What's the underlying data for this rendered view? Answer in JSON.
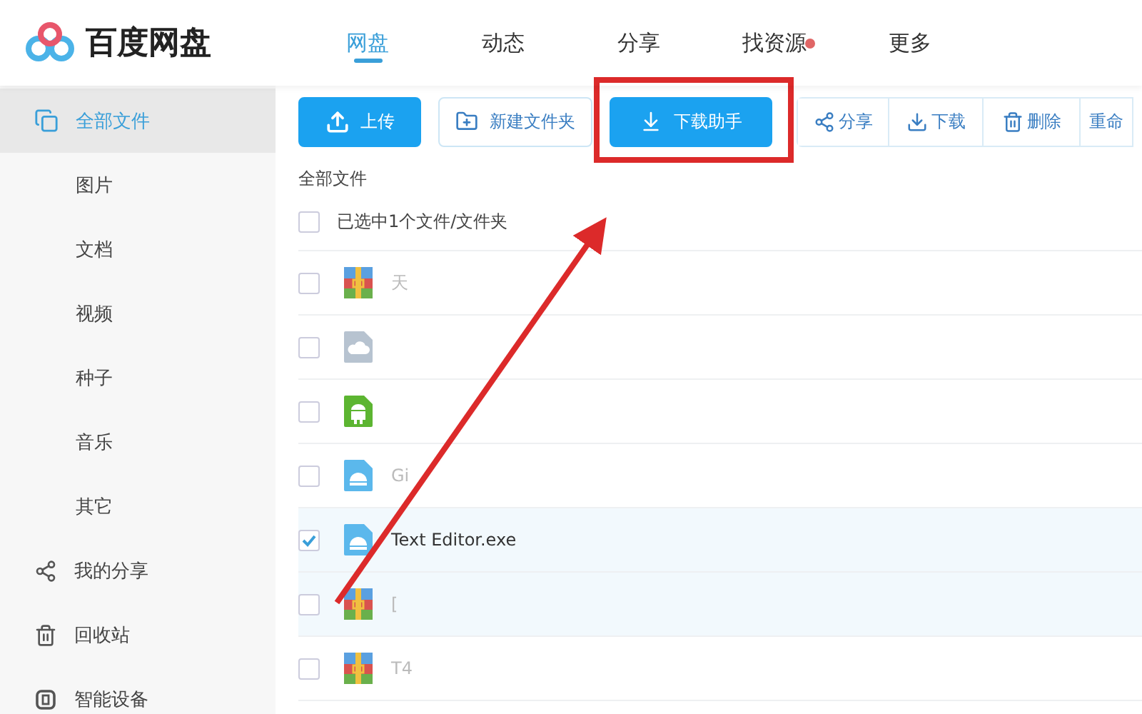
{
  "app": {
    "title": "百度网盘"
  },
  "nav_tabs": [
    {
      "label": "网盘",
      "selected": true,
      "badge": false
    },
    {
      "label": "动态",
      "selected": false,
      "badge": false
    },
    {
      "label": "分享",
      "selected": false,
      "badge": false
    },
    {
      "label": "找资源",
      "selected": false,
      "badge": true
    },
    {
      "label": "更多",
      "selected": false,
      "badge": false
    }
  ],
  "sidebar": {
    "items": [
      {
        "label": "全部文件",
        "kind": "files",
        "selected": true
      },
      {
        "label": "图片",
        "kind": "sub",
        "selected": false
      },
      {
        "label": "文档",
        "kind": "sub",
        "selected": false
      },
      {
        "label": "视频",
        "kind": "sub",
        "selected": false
      },
      {
        "label": "种子",
        "kind": "sub",
        "selected": false
      },
      {
        "label": "音乐",
        "kind": "sub",
        "selected": false
      },
      {
        "label": "其它",
        "kind": "sub",
        "selected": false
      },
      {
        "label": "我的分享",
        "kind": "share",
        "selected": false
      },
      {
        "label": "回收站",
        "kind": "trash",
        "selected": false
      },
      {
        "label": "智能设备",
        "kind": "device",
        "selected": false
      }
    ]
  },
  "toolbar": {
    "buttons": [
      {
        "label": "上传",
        "kind": "upload"
      },
      {
        "label": "新建文件夹",
        "kind": "folder"
      },
      {
        "label": "下载助手",
        "kind": "helper"
      }
    ],
    "group": [
      {
        "label": "分享",
        "kind": "share"
      },
      {
        "label": "下载",
        "kind": "download"
      },
      {
        "label": "删除",
        "kind": "delete"
      },
      {
        "label": "重命",
        "kind": "rename"
      }
    ]
  },
  "breadcrumb": "全部文件",
  "selection_header": {
    "label": "已选中1个文件/文件夹",
    "checked": false
  },
  "files": [
    {
      "name": "天",
      "kind": "archive",
      "checked": false,
      "highlighted": false
    },
    {
      "kind": "cloud",
      "checked": false,
      "highlighted": false
    },
    {
      "kind": "android",
      "checked": false,
      "highlighted": false
    },
    {
      "name": "Gi",
      "kind": "exe",
      "checked": false,
      "highlighted": false
    },
    {
      "name": "Text Editor.exe",
      "kind": "exe",
      "checked": true,
      "highlighted": true
    },
    {
      "name": "[",
      "kind": "archive",
      "checked": false,
      "highlighted": true
    },
    {
      "name": "T4",
      "kind": "archive",
      "checked": false,
      "highlighted": false
    }
  ]
}
